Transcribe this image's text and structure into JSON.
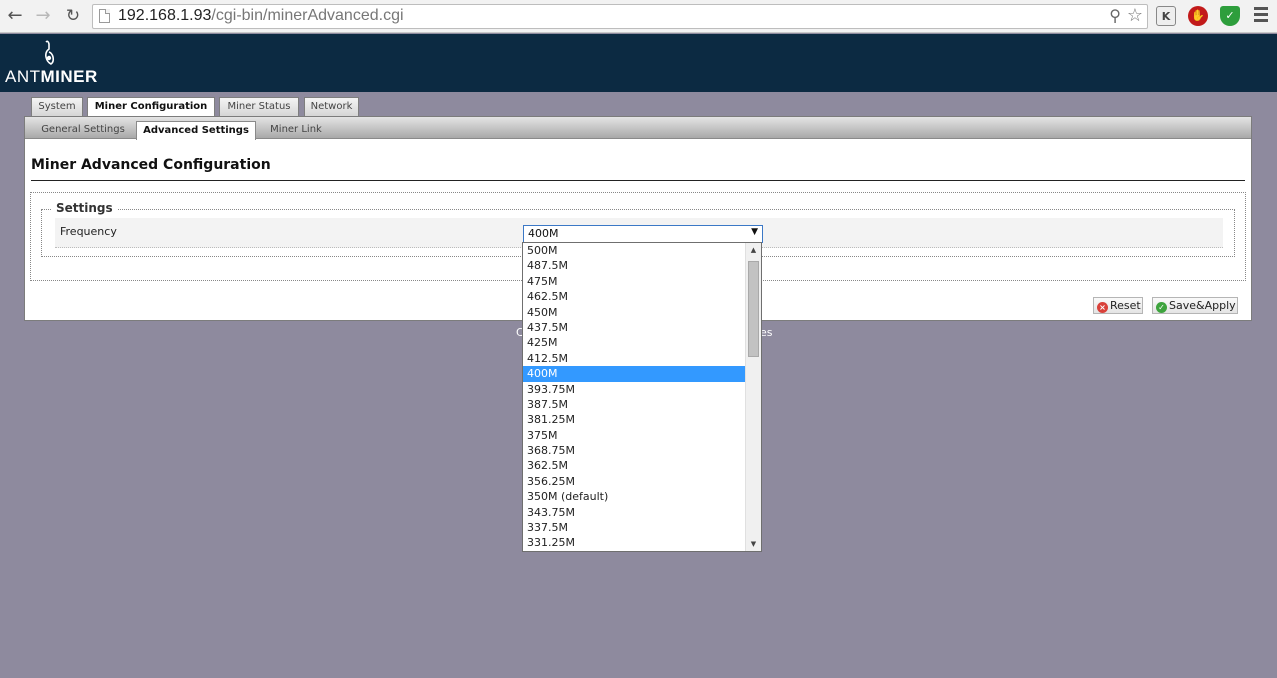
{
  "browser": {
    "url_host": "192.168.1.93",
    "url_path": "/cgi-bin/minerAdvanced.cgi",
    "extension_k": "K"
  },
  "logo": {
    "prefix": "ANT",
    "suffix": "MINER"
  },
  "main_tabs": [
    "System",
    "Miner Configuration",
    "Miner Status",
    "Network"
  ],
  "sub_tabs": [
    "General Settings",
    "Advanced Settings",
    "Miner Link"
  ],
  "page": {
    "title": "Miner Advanced Configuration",
    "legend": "Settings",
    "frequency_label": "Frequency",
    "selected_value": "400M",
    "reset_label": "Reset",
    "save_label": "Save&Apply",
    "footer_left": "C",
    "footer_right": "es"
  },
  "dropdown": {
    "options": [
      "500M",
      "487.5M",
      "475M",
      "462.5M",
      "450M",
      "437.5M",
      "425M",
      "412.5M",
      "400M",
      "393.75M",
      "387.5M",
      "381.25M",
      "375M",
      "368.75M",
      "362.5M",
      "356.25M",
      "350M (default)",
      "343.75M",
      "337.5M",
      "331.25M"
    ],
    "selected_index": 8
  },
  "colors": {
    "header_bg": "#0c2a42",
    "page_bg": "#8e8a9e",
    "selected_option": "#3399ff"
  }
}
